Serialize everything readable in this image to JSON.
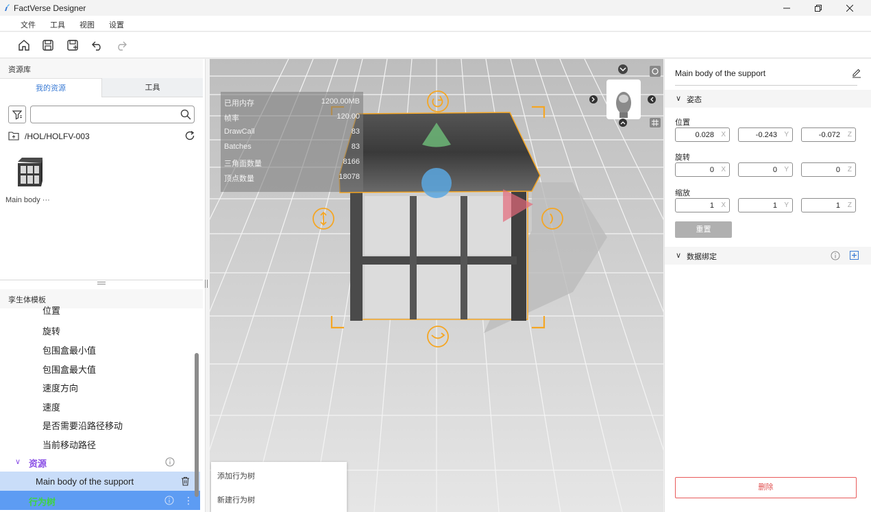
{
  "window": {
    "title": "FactVerse Designer"
  },
  "menu": {
    "file": "文件",
    "tools": "工具",
    "view": "视图",
    "settings": "设置"
  },
  "toolbar": {
    "icons": [
      "home-icon",
      "save-icon",
      "save-as-icon",
      "undo-icon",
      "redo-icon"
    ]
  },
  "asset_library": {
    "header": "资源库",
    "tabs": [
      "我的资源",
      "工具"
    ],
    "search": {
      "value": "",
      "placeholder": ""
    },
    "path": "/HOL/HOLFV-003",
    "assets": [
      {
        "label": "Main body ···"
      }
    ]
  },
  "twin_template": {
    "header": "孪生体模板",
    "properties": [
      "位置",
      "旋转",
      "包围盒最小值",
      "包围盒最大值",
      "速度方向",
      "速度",
      "是否需要沿路径移动",
      "当前移动路径"
    ],
    "assets_section": {
      "label": "资源",
      "item": "Main body of the support"
    },
    "behavior_tree": {
      "label": "行为树"
    }
  },
  "viewport": {
    "stats": [
      {
        "label": "已用内存",
        "value": "1200.00MB"
      },
      {
        "label": "帧率",
        "value": "120.00"
      },
      {
        "label": "DrawCall",
        "value": "83"
      },
      {
        "label": "Batches",
        "value": "83"
      },
      {
        "label": "三角面数量",
        "value": "8166"
      },
      {
        "label": "顶点数量",
        "value": "18078"
      }
    ],
    "context_menu": [
      "添加行为树",
      "新建行为树"
    ]
  },
  "inspector": {
    "title": "Main body of the support",
    "pose_section": "姿态",
    "position": {
      "label": "位置",
      "x": "0.028",
      "y": "-0.243",
      "z": "-0.072"
    },
    "rotation": {
      "label": "旋转",
      "x": "0",
      "y": "0",
      "z": "0"
    },
    "scale": {
      "label": "缩放",
      "x": "1",
      "y": "1",
      "z": "1"
    },
    "axes": {
      "x": "X",
      "y": "Y",
      "z": "Z"
    },
    "reset": "重置",
    "data_binding_section": "数据绑定",
    "delete": "删除"
  },
  "colors": {
    "accent": "#3a7bd5",
    "selection": "#f5a623",
    "asset_purple": "#8a4fe6",
    "bt_green": "#3fd43f",
    "delete_red": "#e05050"
  }
}
